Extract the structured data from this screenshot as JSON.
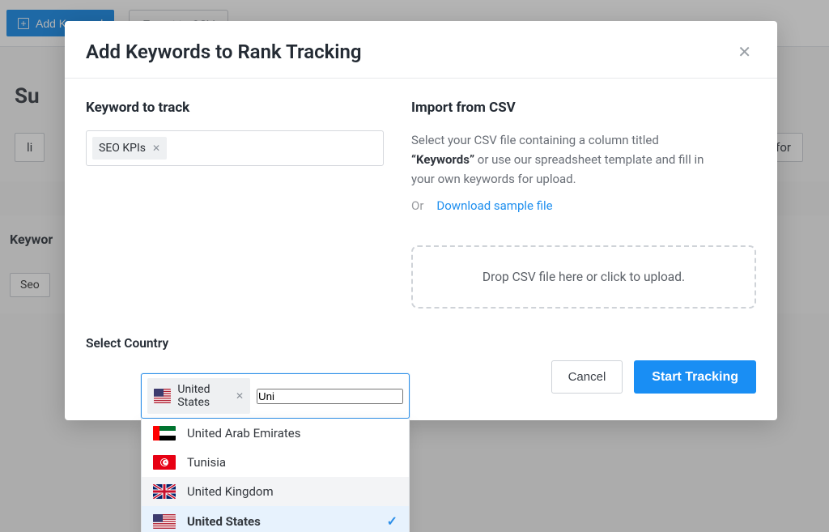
{
  "topbar": {
    "add_keyword_label": "Add Keyword",
    "export_label": "Export to CSV"
  },
  "background": {
    "heading_fragment": "Su",
    "tag_left": "li",
    "tag_right": "for",
    "table_label": "Keywor",
    "chip_label": "Seo"
  },
  "modal": {
    "title": "Add Keywords to Rank Tracking",
    "keyword_label": "Keyword to track",
    "keyword_chip": "SEO KPIs",
    "country_label": "Select Country",
    "country_chip": "United States",
    "country_input_value": "Uni",
    "csv_title": "Import from CSV",
    "csv_text_leading": "Select your CSV file containing a column titled ",
    "csv_text_bold": "“Keywords”",
    "csv_text_trailing": " or use our spreadsheet template and fill in your own keywords for upload.",
    "or_label": "Or",
    "download_link": "Download sample file",
    "dropzone_text": "Drop CSV file here or click to upload.",
    "cancel_label": "Cancel",
    "start_label": "Start Tracking"
  },
  "country_options": [
    {
      "name": "United Arab Emirates",
      "state": "normal"
    },
    {
      "name": "Tunisia",
      "state": "normal"
    },
    {
      "name": "United Kingdom",
      "state": "hover"
    },
    {
      "name": "United States",
      "state": "selected"
    }
  ]
}
